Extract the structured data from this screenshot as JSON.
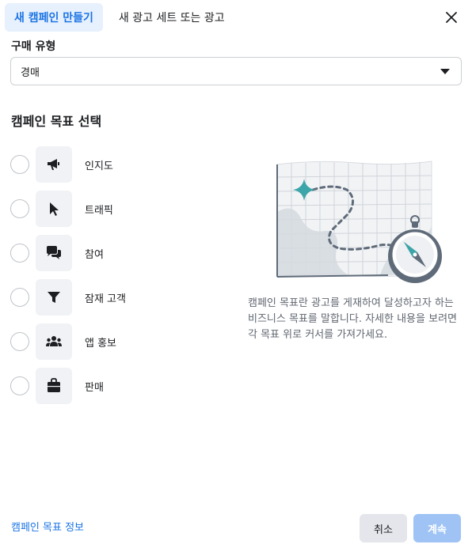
{
  "tabs": [
    {
      "label": "새 캠페인 만들기",
      "active": true
    },
    {
      "label": "새 광고 세트 또는 광고",
      "active": false
    }
  ],
  "buying_type": {
    "label": "구매 유형",
    "value": "경매"
  },
  "objectives": {
    "title": "캠페인 목표 선택",
    "items": [
      {
        "label": "인지도",
        "icon": "megaphone-icon"
      },
      {
        "label": "트래픽",
        "icon": "cursor-icon"
      },
      {
        "label": "참여",
        "icon": "chat-bubbles-icon"
      },
      {
        "label": "잠재 고객",
        "icon": "funnel-icon"
      },
      {
        "label": "앱 홍보",
        "icon": "people-icon"
      },
      {
        "label": "판매",
        "icon": "shopping-bag-icon"
      }
    ]
  },
  "help": {
    "text": "캠페인 목표란 광고를 게재하여 달성하고자 하는 비즈니스 목표를 말합니다. 자세한 내용을 보려면 각 목표 위로 커서를 가져가세요."
  },
  "footer": {
    "info_link": "캠페인 목표 정보",
    "cancel_label": "취소",
    "continue_label": "계속"
  },
  "colors": {
    "accent": "#1b74e4",
    "tab_active_bg": "#e7f0fd",
    "continue_disabled": "#9ec3f4",
    "illustration_teal": "#3ba5a9"
  }
}
